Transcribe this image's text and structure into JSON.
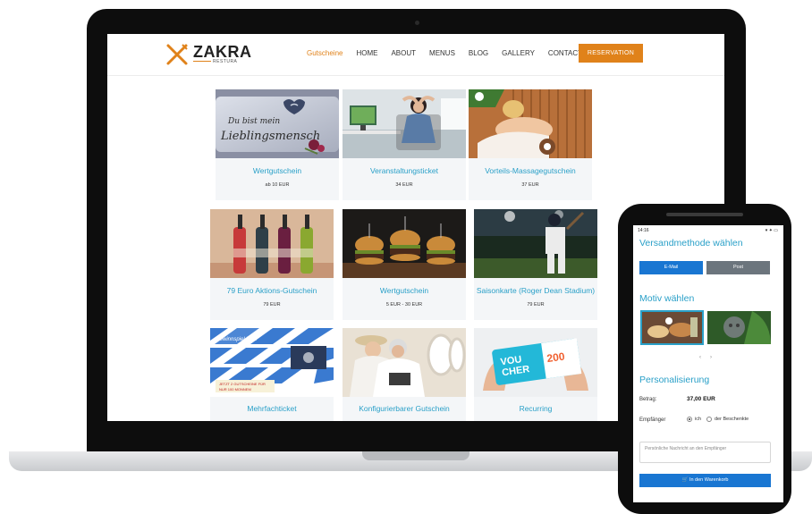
{
  "site": {
    "logo_text": "ZAKRA",
    "logo_sub": "RESTURA",
    "nav": [
      "Gutscheine",
      "HOME",
      "ABOUT",
      "MENUS",
      "BLOG",
      "GALLERY",
      "CONTACT"
    ],
    "reservation_label": "RESERVATION",
    "accent_color": "#e0821a",
    "link_color": "#2aa0c8"
  },
  "cards": [
    {
      "title": "Wertgutschein",
      "price": "ab 10 EUR",
      "image": "cushion-lieblingsmensch",
      "image_text": "Du bist mein Lieblingsmensch"
    },
    {
      "title": "Veranstaltungsticket",
      "price": "34 EUR",
      "image": "woman-relaxing-office"
    },
    {
      "title": "Vorteils-Massagegutschein",
      "price": "37 EUR",
      "image": "massage-spa"
    },
    {
      "title": "79 Euro Aktions-Gutschein",
      "price": "79 EUR",
      "image": "wine-bottles"
    },
    {
      "title": "Wertgutschein",
      "price": "5 EUR - 30 EUR",
      "image": "burgers"
    },
    {
      "title": "Saisonkarte (Roger Dean Stadium)",
      "price": "79 EUR",
      "image": "baseball-player"
    },
    {
      "title": "Mehrfachticket",
      "price": "",
      "image": "oktoberfest-banner",
      "image_text": "Gewinnspiel Fest Oktoberfest ... JETZT 2 GUTSCHEINE FÜR NUR 100 MONNEM"
    },
    {
      "title": "Konfigurierbarer Gutschein",
      "price": "",
      "image": "couple-airplane"
    },
    {
      "title": "Recurring",
      "price": "",
      "image": "voucher-card",
      "image_text": "VOUCHER 200"
    }
  ],
  "phone": {
    "status_time": "14:16",
    "status_right": "▾ ✦ ▭",
    "shipping_heading": "Versandmethode wählen",
    "email_label": "E-Mail",
    "post_label": "Post",
    "motif_heading": "Motiv wählen",
    "carousel_prev": "‹",
    "carousel_next": "›",
    "personalization_heading": "Personalisierung",
    "amount_label": "Betrag:",
    "amount_value": "37,00 EUR",
    "recipient_label": "Empfänger",
    "recipient_opt1": "ich",
    "recipient_opt2": "der Beschenkte",
    "message_placeholder": "Persönliche Nachricht an den Empfänger",
    "cart_label": "In den Warenkorb",
    "primary_color": "#1976d2",
    "secondary_color": "#6c757d"
  }
}
